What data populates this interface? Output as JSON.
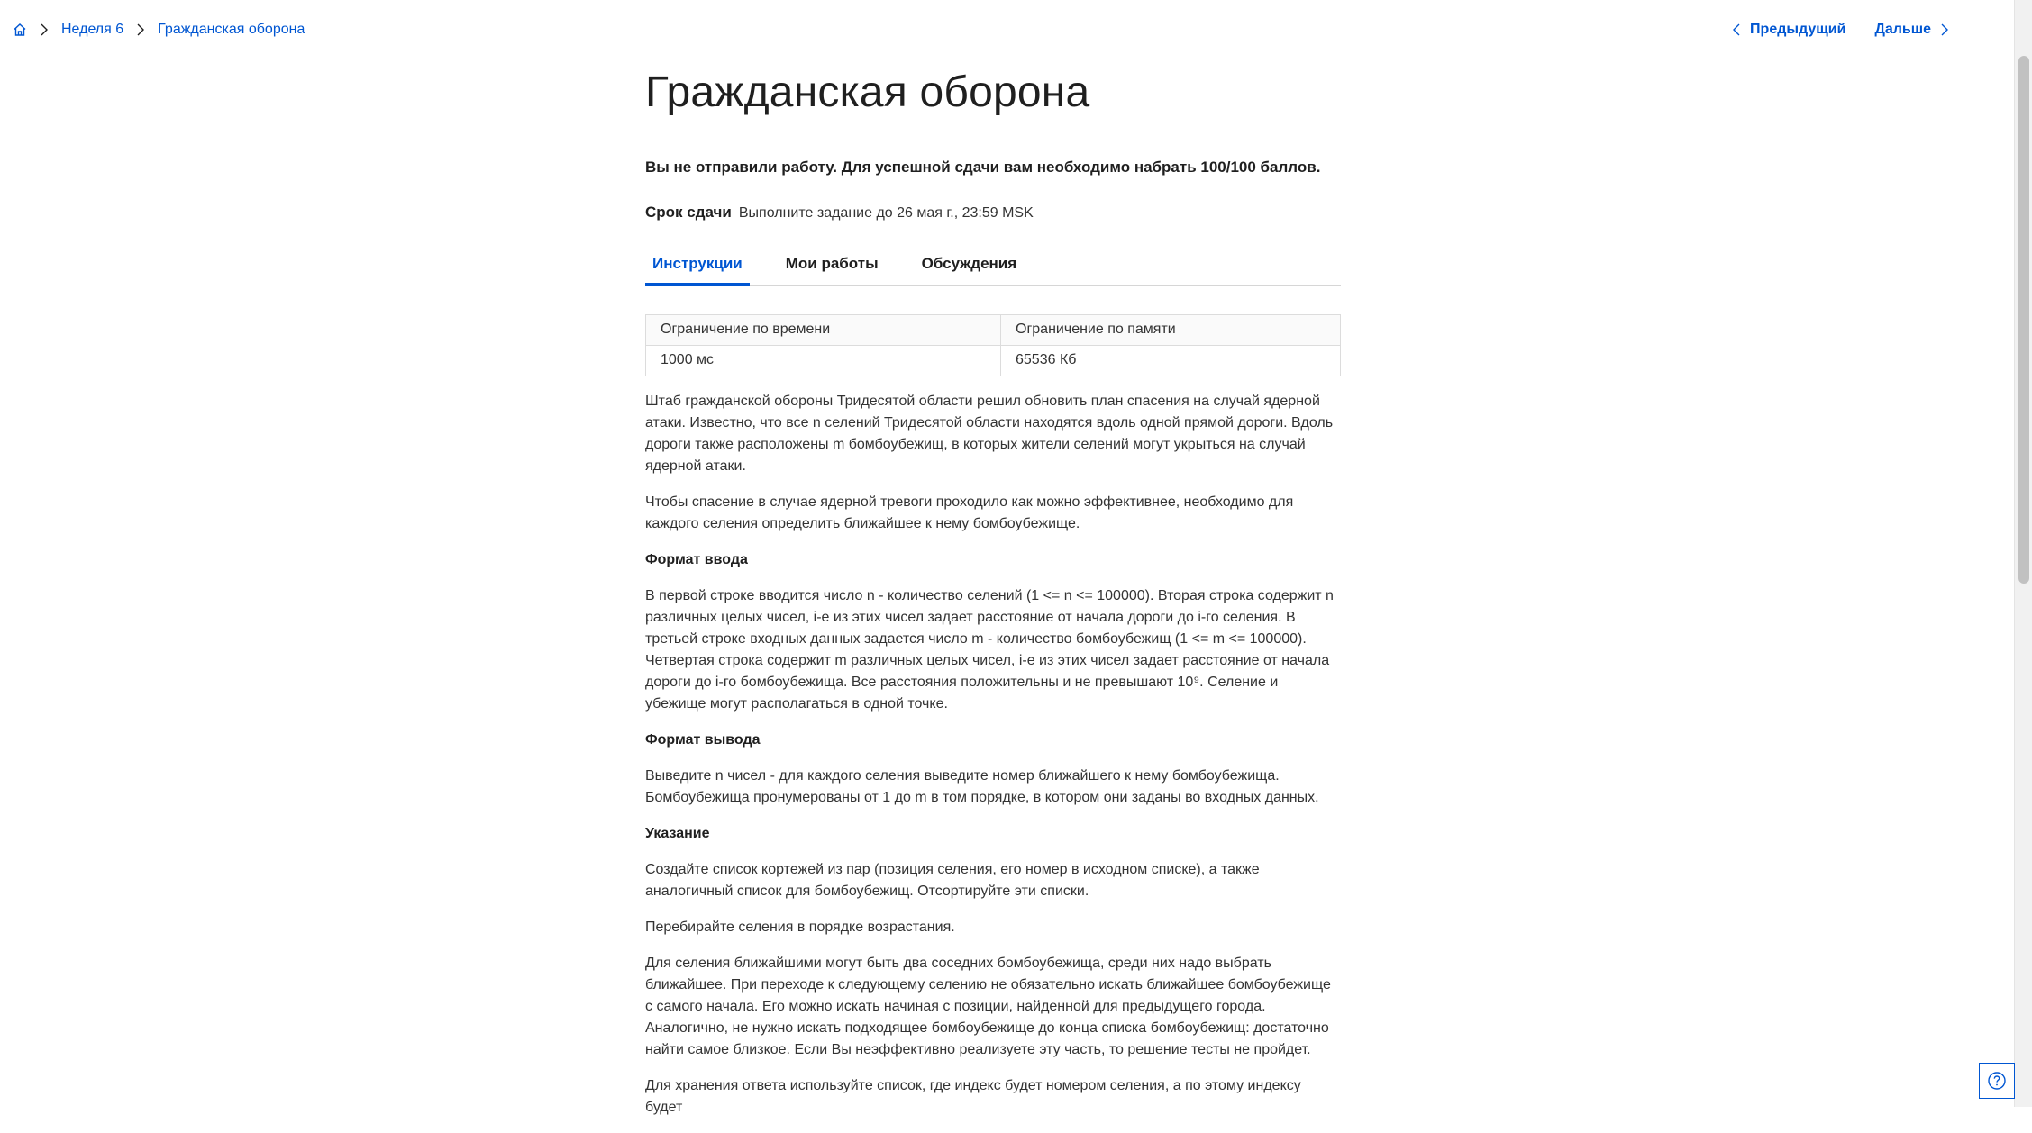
{
  "breadcrumb": {
    "home_icon": "home-icon",
    "items": [
      "Неделя 6",
      "Гражданская оборона"
    ]
  },
  "nav": {
    "previous": "Предыдущий",
    "next": "Дальше"
  },
  "page": {
    "title": "Гражданская оборона",
    "status": "Вы не отправили работу. Для успешной сдачи вам необходимо набрать 100/100 баллов.",
    "deadline_label": "Срок сдачи",
    "deadline_value": "Выполните задание до 26 мая г., 23:59 MSK"
  },
  "tabs": [
    {
      "label": "Инструкции",
      "active": true
    },
    {
      "label": "Мои работы",
      "active": false
    },
    {
      "label": "Обсуждения",
      "active": false
    }
  ],
  "limits_table": {
    "headers": [
      "Ограничение по времени",
      "Ограничение по памяти"
    ],
    "row": [
      "1000 мс",
      "65536 Кб"
    ]
  },
  "content": {
    "p1": "Штаб гражданской обороны Тридесятой области решил обновить план спасения на случай ядерной атаки. Известно, что все n селений Тридесятой области находятся вдоль одной прямой дороги. Вдоль дороги также расположены m бомбоубежищ, в которых жители селений могут укрыться на случай ядерной атаки.",
    "p2": "Чтобы спасение в случае ядерной тревоги проходило как можно эффективнее, необходимо для каждого селения определить ближайшее к нему бомбоубежище.",
    "h_input": "Формат ввода",
    "p_input": "В первой строке вводится число n - количество селений (1 <= n <= 100000). Вторая строка содержит n различных целых чисел, i-е из этих чисел задает расстояние от начала дороги до i-го селения. В третьей строке входных данных задается число m - количество бомбоубежищ (1 <= m <= 100000). Четвертая строка содержит m различных целых чисел, i-е из этих чисел задает расстояние от начала дороги до i-го бомбоубежища. Все расстояния положительны и не превышают 10⁹. Селение и убежище могут располагаться в одной точке.",
    "h_output": "Формат вывода",
    "p_output": "Выведите  n чисел - для каждого селения выведите номер ближайшего к нему бомбоубежища. Бомбоубежища пронумерованы от 1 до m в том порядке, в котором они заданы во входных данных.",
    "h_hint": "Указание",
    "p_hint1": "Создайте список кортежей из пар (позиция селения, его номер в исходном списке), а также аналогичный список для бомбоубежищ. Отсортируйте эти списки.",
    "p_hint2": "Перебирайте селения в порядке возрастания.",
    "p_hint3": "Для селения ближайшими могут быть два соседних бомбоубежища, среди них надо выбрать ближайшее. При переходе к следующему селению не обязательно искать ближайшее бомбоубежище с самого начала. Его можно искать начиная с позиции, найденной для предыдущего города. Аналогично, не нужно искать подходящее бомбоубежище до конца списка бомбоубежищ: достаточно найти самое близкое. Если Вы неэффективно реализуете эту часть, то решение тесты не пройдет.",
    "p_hint4": "Для хранения ответа используйте список, где индекс будет номером селения, а по этому индексу будет"
  },
  "help": {
    "icon": "question-icon"
  }
}
